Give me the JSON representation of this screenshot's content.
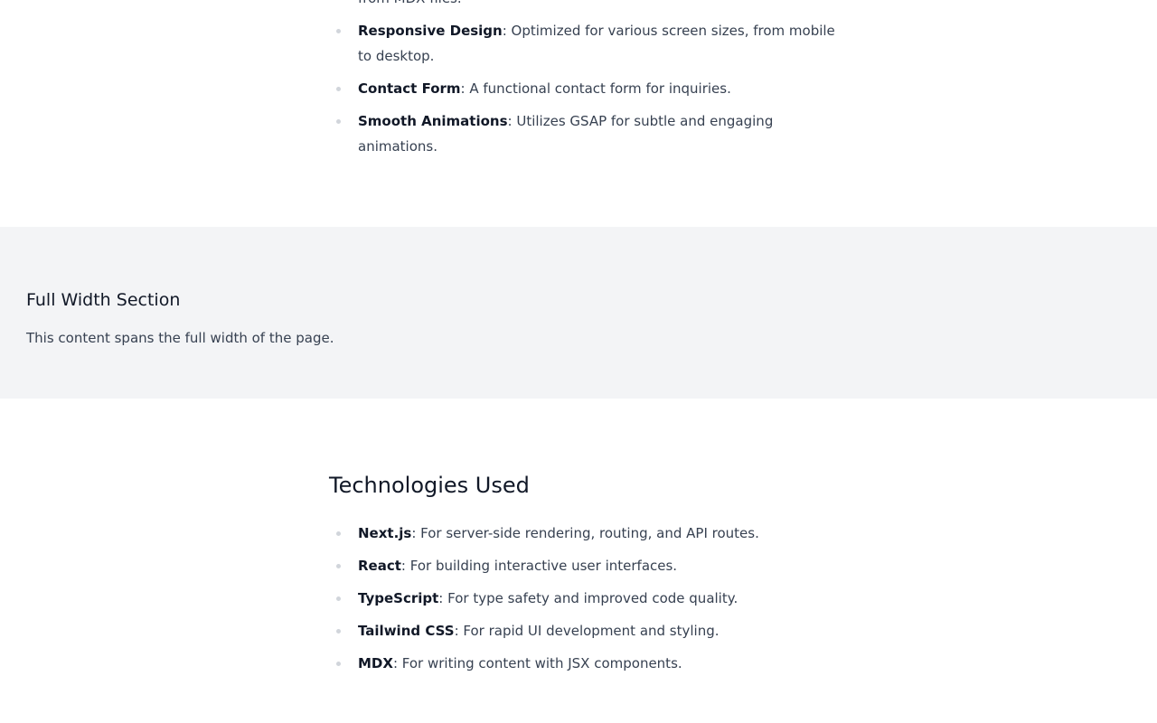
{
  "features": [
    {
      "name": "",
      "desc": "from MDX files."
    },
    {
      "name": "Responsive Design",
      "desc": ": Optimized for various screen sizes, from mobile to desktop."
    },
    {
      "name": "Contact Form",
      "desc": ": A functional contact form for inquiries."
    },
    {
      "name": "Smooth Animations",
      "desc": ": Utilizes GSAP for subtle and engaging animations."
    }
  ],
  "full_width": {
    "title": "Full Width Section",
    "text": "This content spans the full width of the page."
  },
  "technologies": {
    "title": "Technologies Used",
    "items": [
      {
        "name": "Next.js",
        "desc": ": For server-side rendering, routing, and API routes."
      },
      {
        "name": "React",
        "desc": ": For building interactive user interfaces."
      },
      {
        "name": "TypeScript",
        "desc": ": For type safety and improved code quality."
      },
      {
        "name": "Tailwind CSS",
        "desc": ": For rapid UI development and styling."
      },
      {
        "name": "MDX",
        "desc": ": For writing content with JSX components."
      }
    ]
  },
  "colors": {
    "background": "#ffffff",
    "section_background": "#f3f4f6",
    "heading": "#111827",
    "body_text": "#374151",
    "bullet": "#d1d5db"
  }
}
